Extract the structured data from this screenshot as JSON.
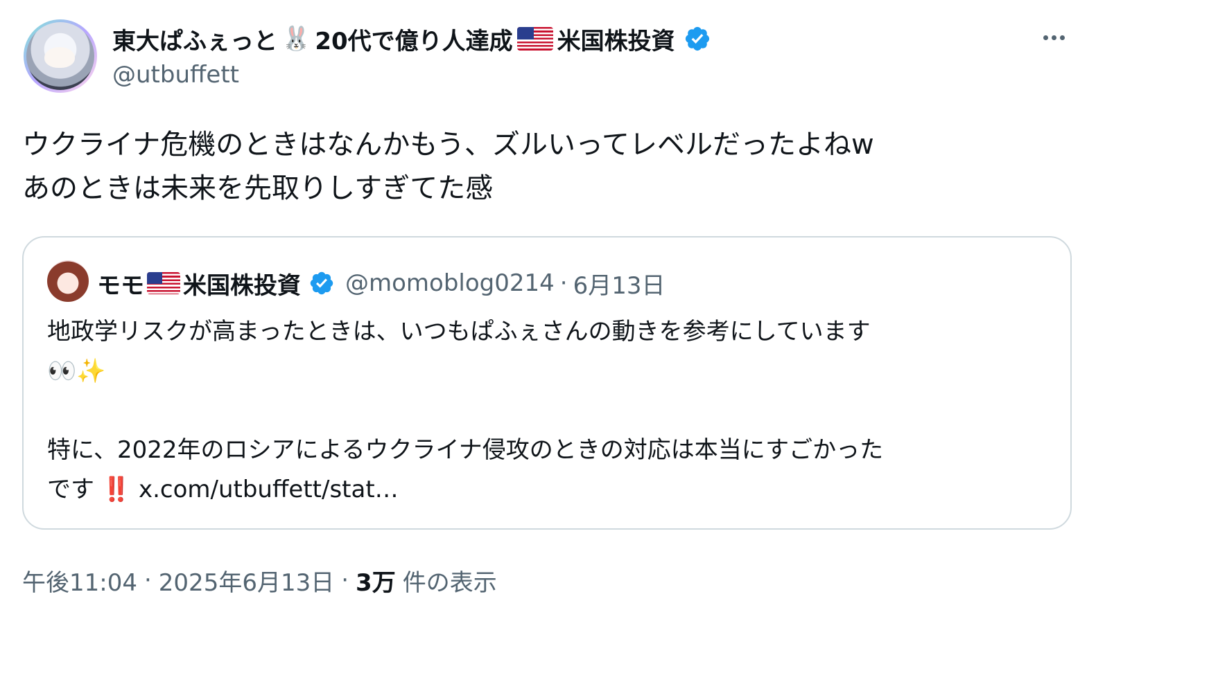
{
  "author": {
    "name_part1": "東大ぱふぇっと",
    "rabbit_emoji": "🐰",
    "name_part2": "20代で億り人達成",
    "name_part3": "米国株投資",
    "handle": "@utbuffett"
  },
  "tweet": {
    "line1": "ウクライナ危機のときはなんかもう、ズルいってレベルだったよねw",
    "line2": "あのときは未来を先取りしすぎてた感"
  },
  "quote": {
    "name_part1": "モモ",
    "name_part2": "米国株投資",
    "handle": "@momoblog0214",
    "separator": "·",
    "date": "6月13日",
    "line1": "地政学リスクが高まったときは、いつもぱふぇさんの動きを参考にしています",
    "eyes_emoji": "👀",
    "sparkles_emoji": "✨",
    "line3": "特に、2022年のロシアによるウクライナ侵攻のときの対応は本当にすごかった",
    "line4_text": "です",
    "exclaim_emoji": "‼️",
    "link": "x.com/utbuffett/stat…"
  },
  "footer": {
    "time": "午後11:04",
    "separator": "·",
    "date": "2025年6月13日",
    "views_count": "3万",
    "views_label": "件の表示"
  },
  "colors": {
    "verified": "#1d9bf0",
    "secondary_text": "#536471",
    "border": "#cfd9de"
  },
  "icons": [
    "verified-badge-icon",
    "more-icon",
    "us-flag-icon",
    "rabbit-icon",
    "eyes-icon",
    "sparkles-icon",
    "double-exclamation-icon"
  ]
}
